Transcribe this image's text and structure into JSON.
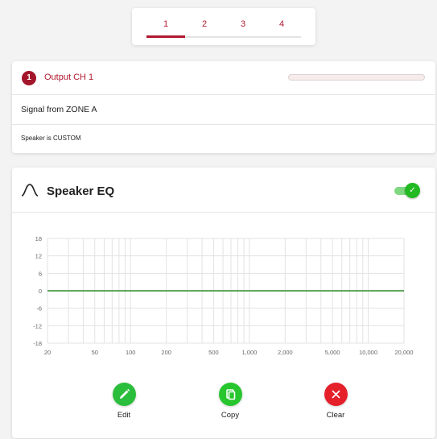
{
  "tabs": [
    {
      "label": "1"
    },
    {
      "label": "2"
    },
    {
      "label": "3"
    },
    {
      "label": "4"
    }
  ],
  "active_tab": "1",
  "channel": {
    "number": "1",
    "name": "Output CH 1",
    "signal": "Signal from ZONE A",
    "speaker": "Speaker is CUSTOM"
  },
  "eq": {
    "title": "Speaker EQ",
    "icon": "curve-icon",
    "enabled": true
  },
  "actions": {
    "edit": {
      "label": "Edit",
      "icon": "pencil-icon",
      "color": "#2bbd3c"
    },
    "copy": {
      "label": "Copy",
      "icon": "copy-icon",
      "color": "#27c62e"
    },
    "clear": {
      "label": "Clear",
      "icon": "close-icon",
      "color": "#e5202b"
    }
  },
  "colors": {
    "accent": "#b0182e",
    "curve": "#2e8b2e"
  },
  "chart_data": {
    "type": "line",
    "x_scale": "log",
    "xlim": [
      20,
      20000
    ],
    "ylim": [
      -18,
      18
    ],
    "x_ticks": [
      "20",
      "50",
      "100",
      "200",
      "500",
      "1,000",
      "2,000",
      "5,000",
      "10,000",
      "20,000"
    ],
    "y_ticks": [
      "18",
      "12",
      "6",
      "0",
      "-6",
      "-12",
      "-18"
    ],
    "grid": true,
    "series": [
      {
        "x": [
          20,
          20000
        ],
        "y": [
          0,
          0
        ]
      }
    ]
  }
}
